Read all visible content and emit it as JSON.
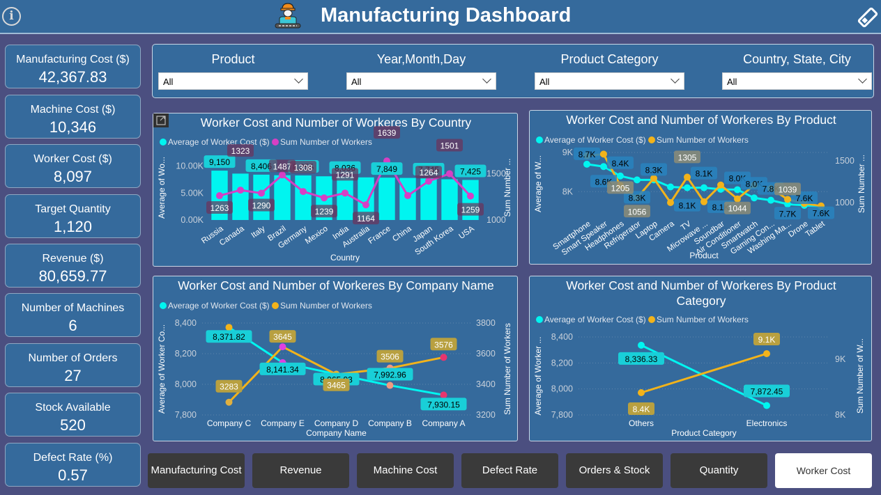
{
  "header": {
    "title": "Manufacturing Dashboard",
    "info_icon": "info-icon",
    "logo_icon": "worker-icon",
    "clear_icon": "eraser-icon"
  },
  "kpis": [
    {
      "label": "Manufacturing Cost ($)",
      "value": "42,367.83"
    },
    {
      "label": "Machine Cost ($)",
      "value": "10,346"
    },
    {
      "label": "Worker Cost ($)",
      "value": "8,097"
    },
    {
      "label": "Target Quantity",
      "value": "1,120"
    },
    {
      "label": "Revenue ($)",
      "value": "80,659.77"
    },
    {
      "label": "Number of Machines",
      "value": "6"
    },
    {
      "label": "Number of Orders",
      "value": "27"
    },
    {
      "label": "Stock Available",
      "value": "520"
    },
    {
      "label": "Defect Rate (%)",
      "value": "0.57"
    }
  ],
  "filters": [
    {
      "label": "Product",
      "value": "All"
    },
    {
      "label": "Year,Month,Day",
      "value": "All"
    },
    {
      "label": "Product Category",
      "value": "All"
    },
    {
      "label": "Country, State, City",
      "value": "All"
    }
  ],
  "nav": {
    "buttons": [
      "Manufacturing Cost",
      "Revenue",
      "Machine Cost",
      "Defect Rate",
      "Orders & Stock",
      "Quantity",
      "Worker Cost"
    ],
    "active": "Worker Cost"
  },
  "colors": {
    "cyan": "#00f5f0",
    "magenta": "#d63fc4",
    "gold": "#f2b31b",
    "panel": "#356a9c",
    "background": "#4b4f80"
  },
  "chart_data": [
    {
      "id": "by-country",
      "type": "bar",
      "title": "Worker Cost and Number of Workeres By Country",
      "xlabel": "Country",
      "ylabel": "Average of Wo...",
      "y2label": "Sum Number ...",
      "legend": [
        "Average of Worker Cost ($)",
        "Sum Number of Workers"
      ],
      "legend_position": "top-left",
      "categories": [
        "Russia",
        "Canada",
        "Italy",
        "Brazil",
        "Germany",
        "Mexico",
        "India",
        "Australia",
        "France",
        "China",
        "Japan",
        "South Korea",
        "USA"
      ],
      "series": [
        {
          "name": "Average of Worker Cost ($)",
          "type": "bar",
          "axis": "left",
          "values": [
            9150,
            8600,
            8406,
            8300,
            8255,
            8100,
            8036,
            7900,
            7849,
            7800,
            7745,
            7550,
            7425
          ],
          "labels": [
            "9,150",
            "",
            "8,406",
            "",
            "8,255",
            "",
            "8,036",
            "",
            "7,849",
            "",
            "7,745",
            "",
            "7,425"
          ]
        },
        {
          "name": "Sum Number of Workers",
          "type": "line",
          "axis": "right",
          "values": [
            1263,
            1323,
            1290,
            1487,
            1308,
            1239,
            1291,
            1164,
            1639,
            1264,
            1420,
            1501,
            1259
          ],
          "labels": [
            "1263",
            "1323",
            "1290",
            "1487",
            "1308",
            "1239",
            "1291",
            "1164",
            "1639",
            "",
            "1264",
            "1501",
            "1259"
          ]
        }
      ],
      "yticks": [
        "0.00K",
        "5.00K",
        "10.00K"
      ],
      "ylim": [
        0,
        12000
      ],
      "y2ticks": [
        "1000",
        "1500"
      ],
      "y2lim": [
        1000,
        1700
      ]
    },
    {
      "id": "by-product",
      "type": "line",
      "title": "Worker Cost and Number of Workeres By Product",
      "xlabel": "Product",
      "ylabel": "Average of W...",
      "y2label": "Sum Number ...",
      "legend": [
        "Average of Worker Cost ($)",
        "Sum Number of Workers"
      ],
      "legend_position": "top-left",
      "categories": [
        "Smartphone",
        "Smart Speaker",
        "Headphones",
        "Refrigerator",
        "Laptop",
        "Camera",
        "TV",
        "Microwave ...",
        "Soundbar",
        "Air Conditioner",
        "Smartwatch",
        "Gaming Con...",
        "Washing Ma...",
        "Drone",
        "Tablet"
      ],
      "series": [
        {
          "name": "Average of Worker Cost ($)",
          "axis": "left",
          "values": [
            8700,
            8640,
            8400,
            8300,
            8300,
            8120,
            8100,
            8100,
            8060,
            8050,
            7840,
            7780,
            7680,
            7650,
            7620
          ],
          "labels": [
            "8.7K",
            "8.6K",
            "8.4K",
            "8.3K",
            "8.3K",
            "",
            "8.1K",
            "8.1K",
            "8.1K",
            "8.0K",
            "8.0K",
            "7.8K",
            "7.7K",
            "7.6K",
            "7.6K"
          ]
        },
        {
          "name": "Sum Number of Workers",
          "axis": "right",
          "values": [
            1560,
            1580,
            1205,
            1056,
            1290,
            1000,
            1305,
            1010,
            1210,
            1044,
            1210,
            1170,
            1039,
            990,
            960
          ],
          "labels": [
            "",
            "",
            "1205",
            "1056",
            "",
            "",
            "1305",
            "",
            "",
            "1044",
            "",
            "",
            "1039",
            "",
            ""
          ]
        }
      ],
      "yticks": [
        "8K",
        "9K"
      ],
      "ylim": [
        7400,
        9000
      ],
      "y2ticks": [
        "1000",
        "1500"
      ],
      "y2lim": [
        850,
        1600
      ]
    },
    {
      "id": "by-company",
      "type": "line",
      "title": "Worker Cost and Number of Workeres By Company Name",
      "xlabel": "Company Name",
      "ylabel": "Average of Worker Co...",
      "y2label": "Sum Number of Workers",
      "legend": [
        "Average of Worker Cost ($)",
        "Sum Number of Workers"
      ],
      "legend_position": "top-left",
      "categories": [
        "Company C",
        "Company E",
        "Company D",
        "Company B",
        "Company A"
      ],
      "series": [
        {
          "name": "Average of Worker Cost ($)",
          "axis": "left",
          "values": [
            8371.82,
            8141.34,
            8065.93,
            7992.96,
            7930.15
          ],
          "labels": [
            "8,371.82",
            "8,141.34",
            "8,065.93",
            "7,992.96",
            "7,930.15"
          ]
        },
        {
          "name": "Sum Number of Workers",
          "axis": "right",
          "values": [
            3283,
            3645,
            3465,
            3506,
            3576
          ],
          "labels": [
            "3283",
            "3645",
            "3465",
            "3506",
            "3576"
          ]
        }
      ],
      "yticks": [
        "7,800",
        "8,000",
        "8,200",
        "8,400"
      ],
      "ylim": [
        7800,
        8400
      ],
      "y2ticks": [
        "3200",
        "3400",
        "3600",
        "3800"
      ],
      "y2lim": [
        3200,
        3800
      ]
    },
    {
      "id": "by-category",
      "type": "line",
      "title": "Worker Cost and Number of Workeres By Product Category",
      "xlabel": "Product Category",
      "ylabel": "Average of Worker ...",
      "y2label": "Sum Number of W...",
      "legend": [
        "Average of Worker Cost ($)",
        "Sum Number of Workers"
      ],
      "legend_position": "top-left",
      "categories": [
        "Others",
        "Electronics"
      ],
      "series": [
        {
          "name": "Average of Worker Cost ($)",
          "axis": "left",
          "values": [
            8336.33,
            7872.45
          ],
          "labels": [
            "8,336.33",
            "7,872.45"
          ]
        },
        {
          "name": "Sum Number of Workers",
          "axis": "right",
          "values": [
            8400,
            9100
          ],
          "labels": [
            "8.4K",
            "9.1K"
          ]
        }
      ],
      "yticks": [
        "7,800",
        "8,000",
        "8,200",
        "8,400"
      ],
      "ylim": [
        7800,
        8400
      ],
      "y2ticks": [
        "8K",
        "9K"
      ],
      "y2lim": [
        8000,
        9400
      ]
    }
  ]
}
